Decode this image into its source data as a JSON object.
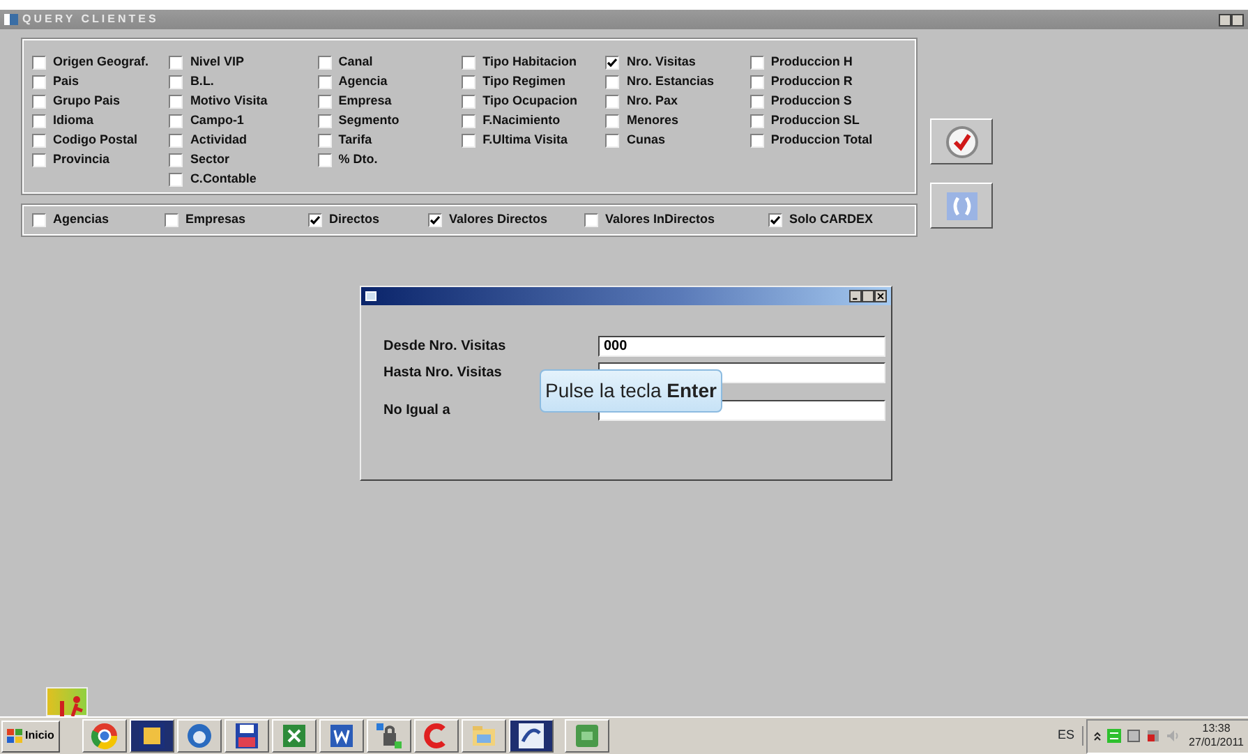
{
  "main_window": {
    "title": "QUERY CLIENTES"
  },
  "fields_panel": {
    "columns": [
      [
        {
          "label": "Origen Geograf.",
          "checked": false
        },
        {
          "label": "Pais",
          "checked": false
        },
        {
          "label": "Grupo Pais",
          "checked": false
        },
        {
          "label": "Idioma",
          "checked": false
        },
        {
          "label": "Codigo Postal",
          "checked": false
        },
        {
          "label": "Provincia",
          "checked": false
        }
      ],
      [
        {
          "label": "Nivel VIP",
          "checked": false
        },
        {
          "label": "B.L.",
          "checked": false
        },
        {
          "label": "Motivo Visita",
          "checked": false
        },
        {
          "label": "Campo-1",
          "checked": false
        },
        {
          "label": "Actividad",
          "checked": false
        },
        {
          "label": "Sector",
          "checked": false
        },
        {
          "label": "C.Contable",
          "checked": false
        }
      ],
      [
        {
          "label": "Canal",
          "checked": false
        },
        {
          "label": "Agencia",
          "checked": false
        },
        {
          "label": "Empresa",
          "checked": false
        },
        {
          "label": "Segmento",
          "checked": false
        },
        {
          "label": "Tarifa",
          "checked": false
        },
        {
          "label": "% Dto.",
          "checked": false
        }
      ],
      [
        {
          "label": "Tipo Habitacion",
          "checked": false
        },
        {
          "label": "Tipo Regimen",
          "checked": false
        },
        {
          "label": "Tipo Ocupacion",
          "checked": false
        },
        {
          "label": "F.Nacimiento",
          "checked": false
        },
        {
          "label": "F.Ultima Visita",
          "checked": false
        }
      ],
      [
        {
          "label": "Nro. Visitas",
          "checked": true
        },
        {
          "label": "Nro. Estancias",
          "checked": false
        },
        {
          "label": "Nro. Pax",
          "checked": false
        },
        {
          "label": "Menores",
          "checked": false
        },
        {
          "label": "Cunas",
          "checked": false
        }
      ],
      [
        {
          "label": "Produccion H",
          "checked": false
        },
        {
          "label": "Produccion R",
          "checked": false
        },
        {
          "label": "Produccion S",
          "checked": false
        },
        {
          "label": "Produccion SL",
          "checked": false
        },
        {
          "label": "Produccion Total",
          "checked": false
        }
      ]
    ]
  },
  "filters": [
    {
      "label": "Agencias",
      "checked": false
    },
    {
      "label": "Empresas",
      "checked": false
    },
    {
      "label": "Directos",
      "checked": true
    },
    {
      "label": "Valores Directos",
      "checked": true
    },
    {
      "label": "Valores InDirectos",
      "checked": false
    },
    {
      "label": "Solo CARDEX",
      "checked": true
    }
  ],
  "dialog": {
    "fields": [
      {
        "label": "Desde Nro. Visitas",
        "value": "000"
      },
      {
        "label": "Hasta Nro. Visitas"
      },
      {
        "label": "No Igual a"
      }
    ]
  },
  "tooltip": {
    "text": "Pulse la tecla **Enter**"
  },
  "taskbar": {
    "start_label": "Inicio",
    "language": "ES",
    "time": "13:38",
    "date": "27/01/2011"
  }
}
